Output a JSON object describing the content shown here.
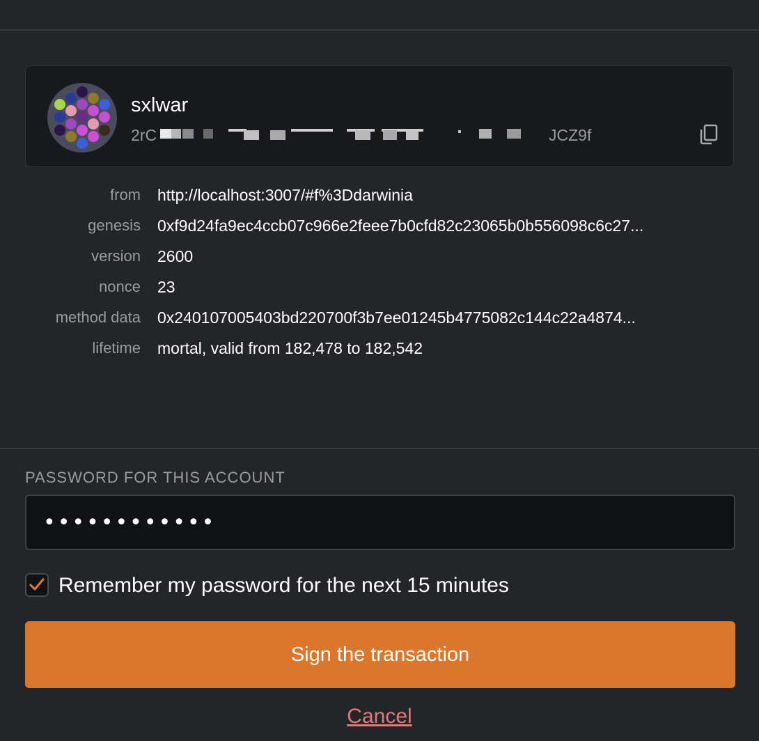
{
  "account": {
    "name": "sxlwar",
    "address_start": "2rC",
    "address_end": "JCZ9f",
    "avatar_icon": "identicon",
    "copy_icon": "copy-icon"
  },
  "details": {
    "rows": [
      {
        "label": "from",
        "value": "http://localhost:3007/#f%3Ddarwinia"
      },
      {
        "label": "genesis",
        "value": "0xf9d24fa9ec4ccb07c966e2feee7b0cfd82c23065b0b556098c6c27..."
      },
      {
        "label": "version",
        "value": "2600"
      },
      {
        "label": "nonce",
        "value": "23"
      },
      {
        "label": "method data",
        "value": "0x240107005403bd220700f3b7ee01245b4775082c144c22a4874..."
      },
      {
        "label": "lifetime",
        "value": "mortal, valid from 182,478 to 182,542"
      }
    ]
  },
  "password": {
    "label": "PASSWORD FOR THIS ACCOUNT",
    "value": "••••••••••••"
  },
  "remember": {
    "label": "Remember my password for the next 15 minutes",
    "checked": true
  },
  "actions": {
    "sign_label": "Sign the transaction",
    "cancel_label": "Cancel"
  },
  "colors": {
    "background": "#242529",
    "accent": "#db772c",
    "cancel": "#e07a7a"
  }
}
